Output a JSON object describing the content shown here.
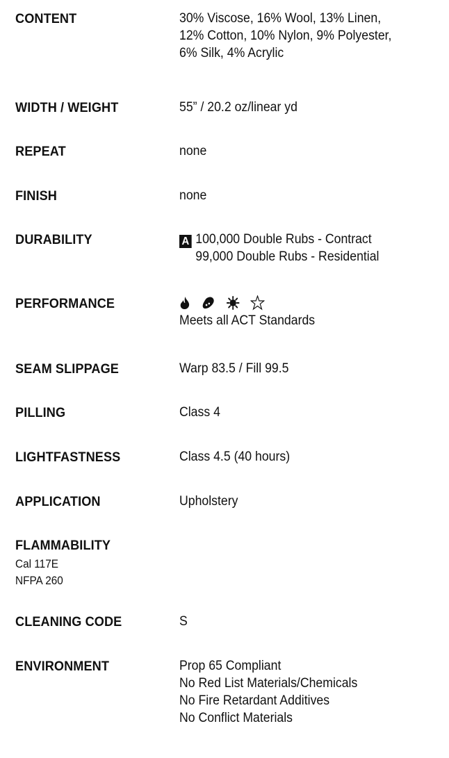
{
  "specs": {
    "content": {
      "label": "CONTENT",
      "lines": [
        "30% Viscose, 16% Wool, 13% Linen,",
        "12% Cotton, 10% Nylon, 9% Polyester,",
        "6% Silk, 4% Acrylic"
      ]
    },
    "width_weight": {
      "label": "WIDTH / WEIGHT",
      "value": "55” / 20.2 oz/linear yd"
    },
    "repeat": {
      "label": "REPEAT",
      "value": "none"
    },
    "finish": {
      "label": "FINISH",
      "value": "none"
    },
    "durability": {
      "label": "DURABILITY",
      "badge": "A",
      "lines": [
        "100,000 Double Rubs - Contract",
        "99,000 Double Rubs - Residential"
      ]
    },
    "performance": {
      "label": "PERFORMANCE",
      "icons": [
        "flammability-icon",
        "wet-cleaning-icon",
        "colorfastness-light-icon",
        "physical-properties-icon"
      ],
      "value": "Meets all ACT Standards"
    },
    "seam_slippage": {
      "label": "SEAM SLIPPAGE",
      "value": "Warp 83.5 / Fill 99.5"
    },
    "pilling": {
      "label": "PILLING",
      "value": "Class 4"
    },
    "lightfastness": {
      "label": "LIGHTFASTNESS",
      "value": "Class 4.5 (40 hours)"
    },
    "application": {
      "label": "APPLICATION",
      "value": "Upholstery"
    },
    "flammability": {
      "label": "FLAMMABILITY",
      "lines": [
        "Cal 117E",
        "NFPA 260"
      ]
    },
    "cleaning_code": {
      "label": "CLEANING CODE",
      "value": "S"
    },
    "environment": {
      "label": "ENVIRONMENT",
      "lines": [
        "Prop 65 Compliant",
        "No Red List Materials/Chemicals",
        "No Fire Retardant Additives",
        "No Conflict Materials"
      ]
    }
  }
}
